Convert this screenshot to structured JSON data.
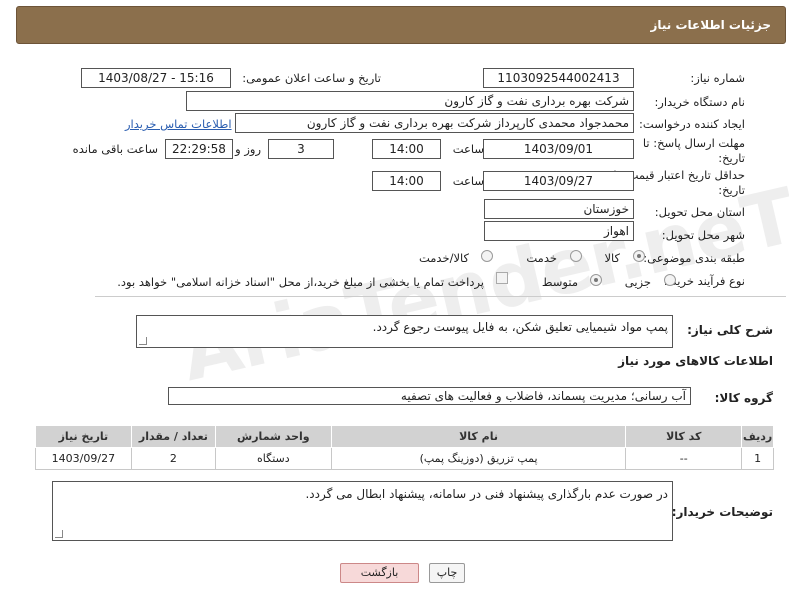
{
  "header": {
    "title": "جزئیات اطلاعات نیاز"
  },
  "need_number": {
    "label": "شماره نیاز:",
    "value": "1103092544002413"
  },
  "announce": {
    "label": "تاریخ و ساعت اعلان عمومی:",
    "value": "1403/08/27 - 15:16"
  },
  "buyer_org": {
    "label": "نام دستگاه خریدار:",
    "value": "شرکت بهره برداری نفت و گاز کارون"
  },
  "creator": {
    "label": "ایجاد کننده درخواست:",
    "value": "محمدجواد محمدی کارپرداز شرکت بهره برداری نفت و گاز کارون",
    "contact_link": "اطلاعات تماس خریدار"
  },
  "deadline": {
    "label1": "مهلت ارسال پاسخ: تا",
    "label2": "تاریخ:",
    "date": "1403/09/01",
    "time_label": "ساعت",
    "time": "14:00",
    "days": "3",
    "days_label": "روز و",
    "remaining": "22:29:58",
    "remaining_label": "ساعت باقی مانده"
  },
  "price_validity": {
    "label1": "حداقل تاریخ اعتبار قیمت: تا",
    "label2": "تاریخ:",
    "date": "1403/09/27",
    "time_label": "ساعت",
    "time": "14:00"
  },
  "province": {
    "label": "استان محل تحویل:",
    "value": "خوزستان"
  },
  "city": {
    "label": "شهر محل تحویل:",
    "value": "اهواز"
  },
  "category": {
    "label": "طبقه بندی موضوعی:",
    "options": [
      "کالا",
      "خدمت",
      "کالا/خدمت"
    ],
    "selected": "کالا"
  },
  "process": {
    "label": "نوع فرآیند خرید :",
    "options": [
      "جزیی",
      "متوسط"
    ],
    "note": "پرداخت تمام یا بخشی از مبلغ خرید،از محل \"اسناد خزانه اسلامی\" خواهد بود."
  },
  "description": {
    "label": "شرح کلی نیاز:",
    "value": "پمپ مواد شیمیایی تعلیق شکن، به فایل پیوست رجوع گردد."
  },
  "goods_info": {
    "title": "اطلاعات کالاهای مورد نیاز"
  },
  "goods_group": {
    "label": "گروه کالا:",
    "value": "آب رسانی؛ مدیریت پسماند، فاضلاب و فعالیت های تصفیه"
  },
  "table": {
    "headers": [
      "ردیف",
      "کد کالا",
      "نام کالا",
      "واحد شمارش",
      "تعداد / مقدار",
      "تاریخ نیاز"
    ],
    "rows": [
      [
        "1",
        "--",
        "پمپ تزریق (دوزینگ پمپ)",
        "دستگاه",
        "2",
        "1403/09/27"
      ]
    ]
  },
  "buyer_notes": {
    "label": "توضیحات خریدار:",
    "value": "در صورت عدم بارگذاری پیشنهاد فنی در سامانه، پیشنهاد ابطال می گردد."
  },
  "buttons": {
    "print": "چاپ",
    "back": "بازگشت"
  },
  "watermark": "AriaTender.neT",
  "colors": {
    "header_bg": "#8b6f4c",
    "table_header_bg": "#d2d2d2",
    "back_button_bg": "#f7d9d9"
  }
}
